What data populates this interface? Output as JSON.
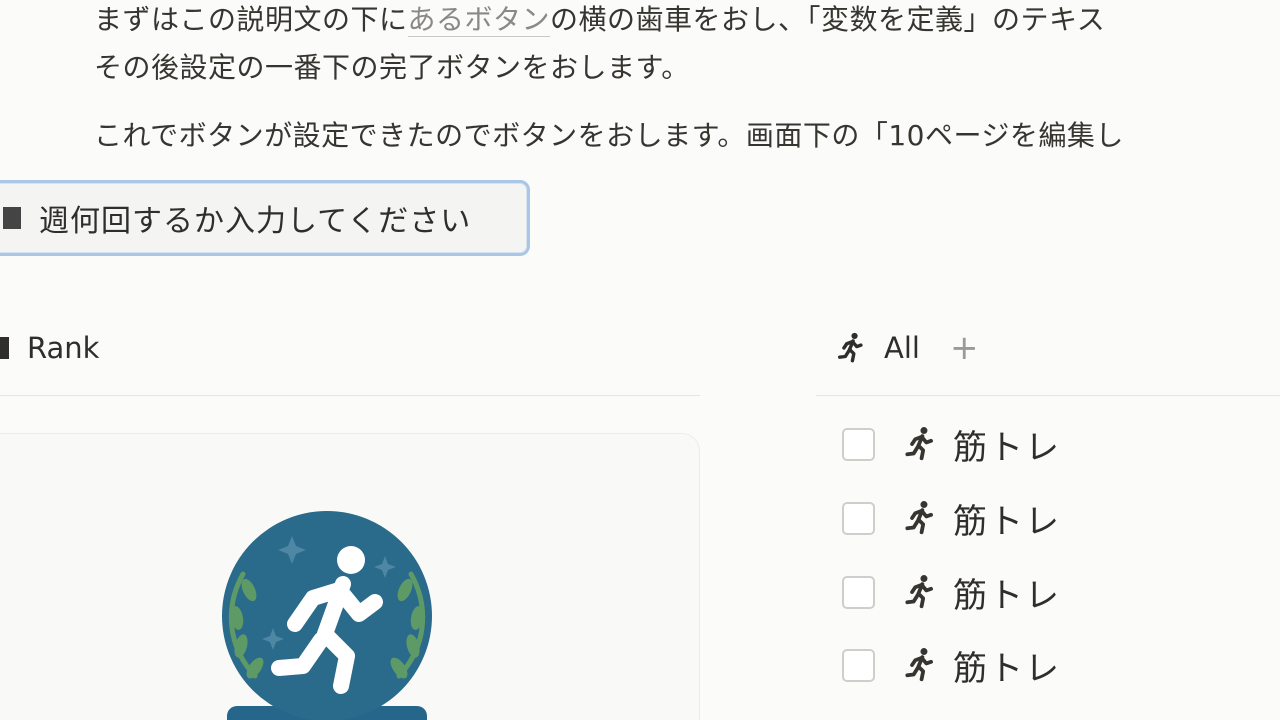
{
  "instructions": {
    "line1_before": "まずはこの説明文の下に",
    "line1_link": "あるボタン",
    "line1_after": "の横の歯車をおし、「変数を定義」のテキス",
    "line2": "その後設定の一番下の完了ボタンをおします。",
    "line3": "これでボタンが設定できたのでボタンをおします。画面下の「10ページを編集し"
  },
  "prompt_button": {
    "label": "週何回するか入力してください"
  },
  "rank_section": {
    "title": "Rank"
  },
  "all_section": {
    "title": "All",
    "add_label": "+"
  },
  "tasks": [
    {
      "label": "筋トレ",
      "checked": false
    },
    {
      "label": "筋トレ",
      "checked": false
    },
    {
      "label": "筋トレ",
      "checked": false
    },
    {
      "label": "筋トレ",
      "checked": false
    }
  ],
  "colors": {
    "badge_circle": "#2a6a8b",
    "badge_base": "#26668a",
    "laurel": "#5e9a66"
  }
}
